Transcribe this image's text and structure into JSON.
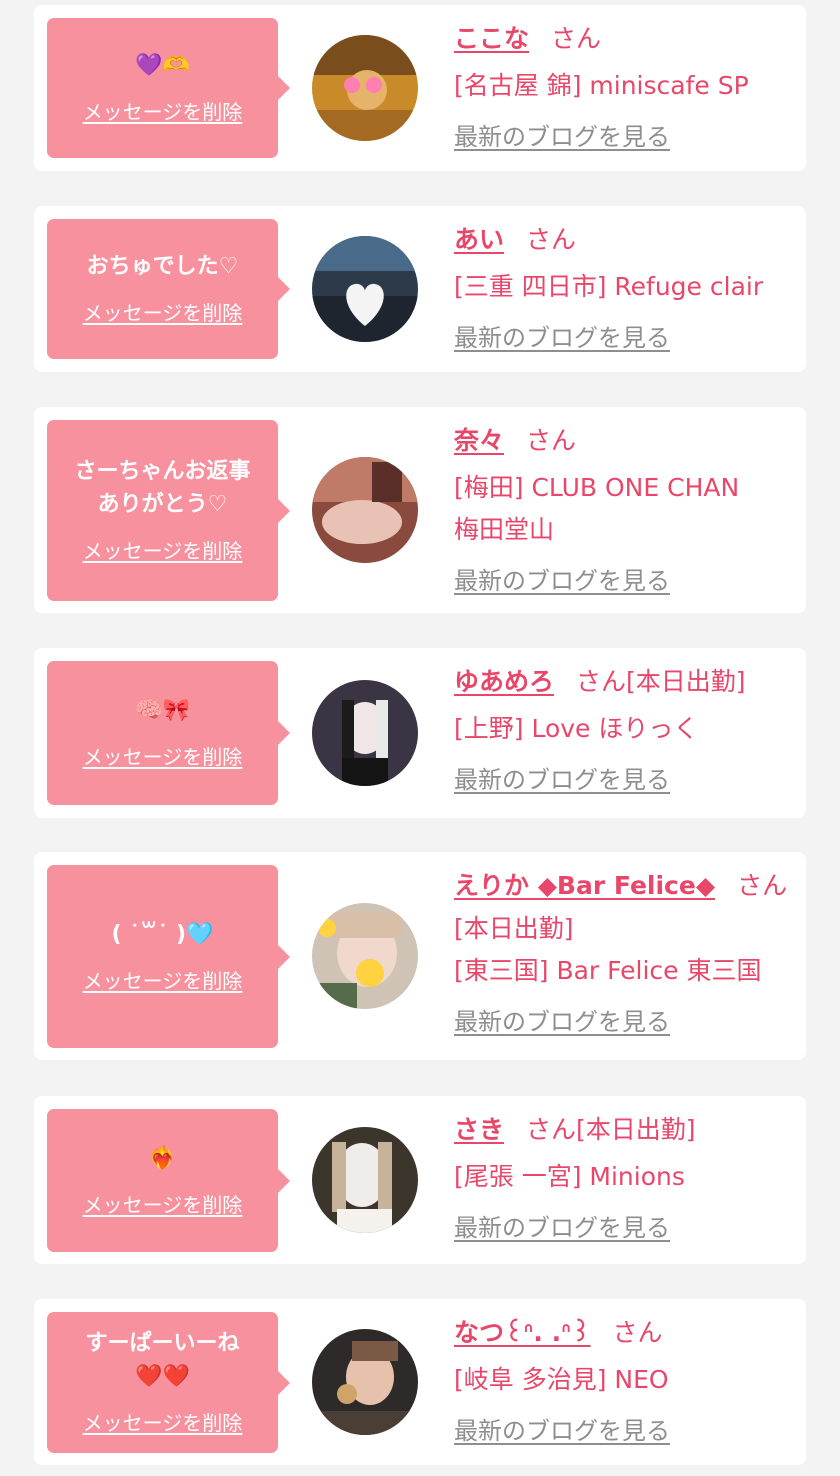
{
  "colors": {
    "background": "#f3f3f3",
    "card": "#ffffff",
    "bubble": "#f7919e",
    "accent_text": "#e8476a",
    "link_gray": "#8e8e8e"
  },
  "delete_label": "メッセージを削除",
  "san_label": "さん",
  "blog_label": "最新のブログを見る",
  "messages": [
    {
      "message": "💜🫶",
      "name": "ここな",
      "san": "さん",
      "shop_lines": [
        "[名古屋 錦] miniscafe SP"
      ],
      "avatar_icon": "avatar-photo-icon"
    },
    {
      "message": "おちゅでした♡",
      "name": "あい",
      "san": "さん",
      "shop_lines": [
        "[三重 四日市] Refuge clair"
      ],
      "avatar_icon": "avatar-photo-icon"
    },
    {
      "message": "さーちゃんお返事\nありがとう♡",
      "name": "奈々",
      "san": "さん",
      "shop_lines": [
        "[梅田] CLUB ONE CHAN",
        "梅田堂山"
      ],
      "avatar_icon": "avatar-photo-icon"
    },
    {
      "message": "🧠🎀",
      "name": "ゆあめろ",
      "san": "さん[本日出勤]",
      "shop_lines": [
        "[上野] Love ほりっく"
      ],
      "avatar_icon": "avatar-photo-icon"
    },
    {
      "message": "( ˙꒳​˙ )🩵",
      "name": "えりか ◆Bar Felice◆",
      "san": "さん",
      "shop_lines": [
        "[本日出勤]",
        "[東三国] Bar Felice 東三国"
      ],
      "avatar_icon": "avatar-photo-icon"
    },
    {
      "message": "❤️‍🔥",
      "name": "さき",
      "san": "さん[本日出勤]",
      "shop_lines": [
        "[尾張 一宮] Minions"
      ],
      "avatar_icon": "avatar-photo-icon"
    },
    {
      "message": "すーぱーいーね\n❤️❤️",
      "name": "なつ꒰ᐢ. .ᐢ꒱",
      "san": "さん",
      "shop_lines": [
        "[岐阜 多治見] NEO"
      ],
      "avatar_icon": "avatar-photo-icon"
    }
  ]
}
